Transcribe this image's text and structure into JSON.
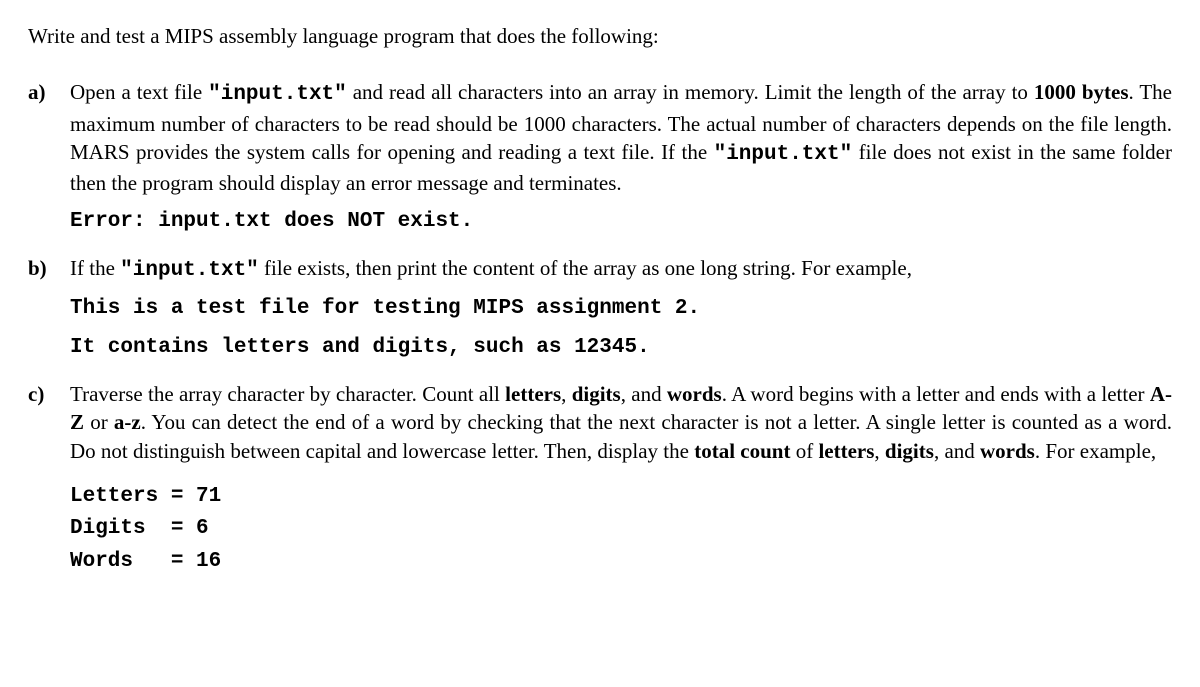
{
  "intro": "Write and test a MIPS assembly language program that does the following:",
  "items": {
    "a": {
      "marker": "a)",
      "t1": "Open a text file ",
      "file1": "\"input.txt\"",
      "t2": " and read all characters into an array in memory. Limit the length of the array to ",
      "bytes": "1000 bytes",
      "t3": ". The maximum number of characters to be read should be 1000 characters. The actual number of characters depends on the file length. MARS provides the system calls for opening and reading a text file. If the ",
      "file2": "\"input.txt\"",
      "t4": " file does not exist in the same folder then the program should display an error message and terminates.",
      "err": "Error: input.txt does NOT exist."
    },
    "b": {
      "marker": "b)",
      "t1": "If the ",
      "file1": "\"input.txt\"",
      "t2": " file exists, then print the content of the array as one long string. For example,",
      "line1": "This is a test file for testing MIPS assignment 2.",
      "line2": "It contains letters and digits, such as 12345."
    },
    "c": {
      "marker": "c)",
      "t1": "Traverse the array character by character. Count all ",
      "b1": "letters",
      "t2": ", ",
      "b2": "digits",
      "t3": ", and ",
      "b3": "words",
      "t4": ". A word begins with a letter and ends with a letter ",
      "b4": "A-Z",
      "t5": " or ",
      "b5": "a-z",
      "t6": ". You can detect the end of a word by checking that the next character is not a letter. A single letter is counted as a word. Do not distinguish between capital and lowercase letter. Then, display the ",
      "b6": "total count",
      "t7": " of ",
      "b7": "letters",
      "t8": ", ",
      "b8": "digits",
      "t9": ", and ",
      "b9": "words",
      "t10": ". For example,",
      "out1": "Letters = 71",
      "out2": "Digits  = 6",
      "out3": "Words   = 16"
    }
  }
}
